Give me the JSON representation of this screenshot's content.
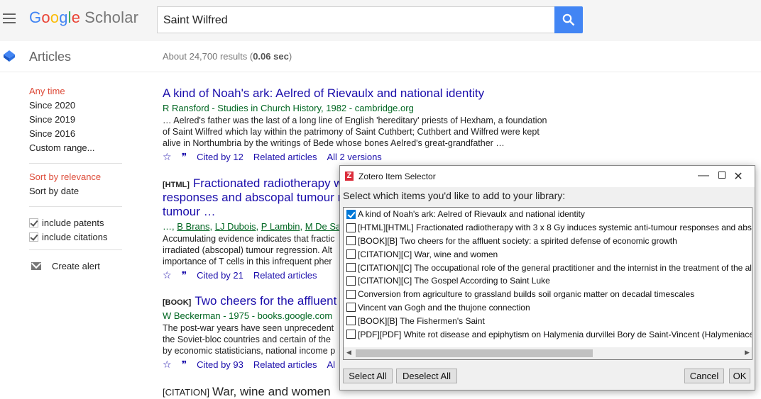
{
  "header": {
    "logo_google": [
      "G",
      "o",
      "o",
      "g",
      "l",
      "e"
    ],
    "logo_scholar": "Scholar",
    "search_value": "Saint Wilfred"
  },
  "subbar": {
    "articles_label": "Articles",
    "results_prefix": "About 24,700 results (",
    "results_time": "0.06 sec",
    "results_suffix": ")"
  },
  "sidebar": {
    "time_items": [
      "Any time",
      "Since 2020",
      "Since 2019",
      "Since 2016",
      "Custom range..."
    ],
    "sort_items": [
      "Sort by relevance",
      "Sort by date"
    ],
    "checkboxes": [
      "include patents",
      "include citations"
    ],
    "create_alert": "Create alert"
  },
  "results": [
    {
      "title": "A kind of Noah's ark: Aelred of Rievaulx and national identity",
      "authors": "R Ransford - Studies in Church History, 1982 - cambridge.org",
      "snippet_lines": [
        "… Aelred's father was the last of a long line of English 'hereditary' priests of Hexham, a foundation",
        "of Saint Wilfred which lay within the patrimony of Saint Cuthbert; Cuthbert and Wilfred were kept",
        "alive in Northumbria by the writings of Bede whose bones Aelred's great-grandfather …"
      ],
      "cited_by": "Cited by 12",
      "related": "Related articles",
      "versions": "All 2 versions"
    },
    {
      "tag": "[HTML]",
      "title_lines": [
        "Fractionated radiotherapy w",
        "responses and abscopal tumour r",
        "tumour …"
      ],
      "authors_parts": [
        "…, ",
        "B Brans",
        ", ",
        "LJ Dubois",
        ", ",
        "P Lambin",
        ", ",
        "M De Sa"
      ],
      "snippet_lines": [
        "Accumulating evidence indicates that fractic",
        "irradiated (abscopal) tumour regression. Alt",
        "importance of T cells in this infrequent pher"
      ],
      "cited_by": "Cited by 21",
      "related": "Related articles"
    },
    {
      "tag": "[BOOK]",
      "title": "Two cheers for the affluent",
      "authors": "W Beckerman - 1975 - books.google.com",
      "snippet_lines": [
        "The post-war years have seen unprecedent",
        "the Soviet-bloc countries and certain of the",
        "by economic statisticians, national income p"
      ],
      "cited_by": "Cited by 93",
      "related": "Related articles",
      "versions_partial": "Al"
    },
    {
      "tag": "[CITATION]",
      "title": "War, wine and women"
    }
  ],
  "dialog": {
    "title": "Zotero Item Selector",
    "prompt": "Select which items you'd like to add to your library:",
    "items": [
      {
        "label": "A kind of Noah's ark: Aelred of Rievaulx and national identity",
        "checked": true
      },
      {
        "label": "[HTML][HTML] Fractionated radiotherapy with 3 x 8 Gy induces systemic anti-tumour responses and abscopal",
        "checked": false
      },
      {
        "label": "[BOOK][B] Two cheers for the affluent society: a spirited defense of economic growth",
        "checked": false
      },
      {
        "label": "[CITATION][C] War, wine and women",
        "checked": false
      },
      {
        "label": "[CITATION][C] The occupational role of the general practitioner and the internist in the treatment of the alco",
        "checked": false
      },
      {
        "label": "[CITATION][C] The Gospel According to Saint Luke",
        "checked": false
      },
      {
        "label": "Conversion from agriculture to grassland builds soil organic matter on decadal timescales",
        "checked": false
      },
      {
        "label": "Vincent van Gogh and the thujone connection",
        "checked": false
      },
      {
        "label": "[BOOK][B] The Fishermen's Saint",
        "checked": false
      },
      {
        "label": "[PDF][PDF] White rot disease and epiphytism on Halymenia durvillei Bory de Saint-Vincent (Halymeniace",
        "checked": false
      }
    ],
    "buttons": {
      "select_all": "Select All",
      "deselect_all": "Deselect All",
      "cancel": "Cancel",
      "ok": "OK"
    }
  },
  "colors": {
    "link": "#1a0dab",
    "green": "#006621",
    "selected_red": "#dd4b39",
    "search_blue": "#4285f4",
    "zotero_red": "#db2c3a"
  }
}
